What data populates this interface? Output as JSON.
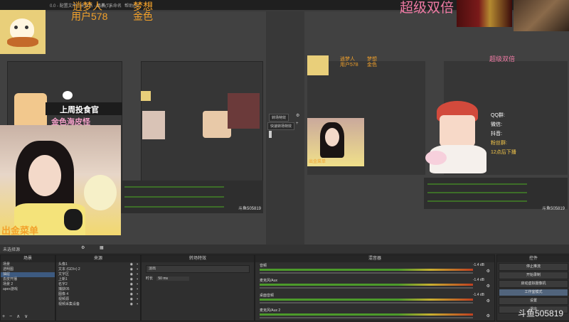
{
  "titlebar": {
    "title_fragment": "0.0 - 配置文件 : 未命名 - 场景 : 未命名",
    "menu": [
      "工具(T)",
      "帮助(H)"
    ]
  },
  "overlay": {
    "streamer_line1": "逍梦人",
    "streamer_line2": "用户578",
    "dream_line1": "梦想",
    "dream_line2": "金色",
    "super_double": "超级双倍",
    "badge1": "上周投食官",
    "badge2": "金色海皮怪",
    "bottom_left_text": "出金菜单",
    "stream_id": "斗鱼505819",
    "announcement_line1": "QQ群:",
    "announcement_line2": "微信:",
    "announcement_line3": "抖音:",
    "announcement_line4": "粉丝群:",
    "announcement_line5": "12点后下播"
  },
  "transition": {
    "btn1": "转场特效",
    "btn2": "快速转场特效"
  },
  "bottom": {
    "left_status": "未选择源",
    "scenes": {
      "title": "场景",
      "items": [
        "场景",
        "透明图",
        "抽屉",
        "去皮开播",
        "场景 2",
        "apex游戏"
      ],
      "selected": 2
    },
    "sources": {
      "title": "来源",
      "items": [
        "头像1",
        "文本 (GDI+) 2",
        "文字区",
        "上新1",
        "名字2",
        "捕获05",
        "图像 4",
        "视频源",
        "视频采集设备"
      ]
    },
    "transition_dock": {
      "title": "转场特效",
      "type_label": "淡出",
      "duration_label": "时长",
      "duration_value": "50 ms"
    },
    "mixer": {
      "title": "混音器",
      "channels": [
        {
          "name": "音频",
          "db": "-1.4 dB"
        },
        {
          "name": "麦克风/Aux",
          "db": "-1.4 dB"
        },
        {
          "name": "桌面音频",
          "db": "-1.4 dB"
        },
        {
          "name": "麦克风/Aux 2",
          "db": ""
        }
      ]
    },
    "controls": {
      "title": "控件",
      "buttons": [
        "停止推流",
        "开始录制",
        "启动虚拟摄像机",
        "工作室模式",
        "设置",
        "退出"
      ],
      "active_index": 3
    }
  }
}
